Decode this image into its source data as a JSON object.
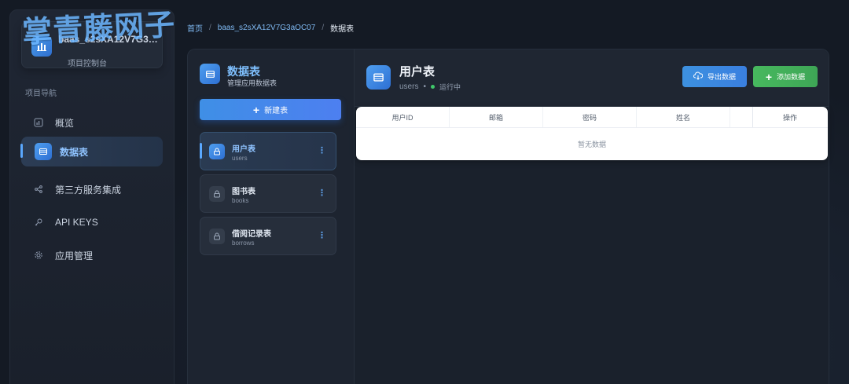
{
  "watermark": "掌青藤网子",
  "project": {
    "name": "baas_s2sXA12V7G3aOC07",
    "subtitle": "项目控制台"
  },
  "nav": {
    "section": "项目导航",
    "items": [
      {
        "label": "概览",
        "icon": "bar-chart-icon"
      },
      {
        "label": "数据表",
        "icon": "table-icon"
      },
      {
        "label": "第三方服务集成",
        "icon": "share-icon"
      },
      {
        "label": "API KEYS",
        "icon": "key-icon"
      },
      {
        "label": "应用管理",
        "icon": "gear-icon"
      }
    ],
    "active_index": 1
  },
  "breadcrumb": {
    "home": "首页",
    "project": "baas_s2sXA12V7G3aOC07",
    "current": "数据表",
    "sep": "/"
  },
  "tables_panel": {
    "title": "数据表",
    "subtitle": "管理应用数据表",
    "new_button": "新建表",
    "items": [
      {
        "name": "用户表",
        "key": "users"
      },
      {
        "name": "图书表",
        "key": "books"
      },
      {
        "name": "借阅记录表",
        "key": "borrows"
      }
    ],
    "active_index": 0
  },
  "detail": {
    "title": "用户表",
    "key": "users",
    "separator": "•",
    "status": "运行中",
    "export_button": "导出数据",
    "add_button": "添加数据",
    "columns": [
      "用户ID",
      "邮箱",
      "密码",
      "姓名",
      "",
      "操作"
    ],
    "empty_text": "暂无数据"
  },
  "colors": {
    "accent": "#4f9ff0",
    "success": "#47b85e",
    "status_running": "#3fc76a"
  }
}
